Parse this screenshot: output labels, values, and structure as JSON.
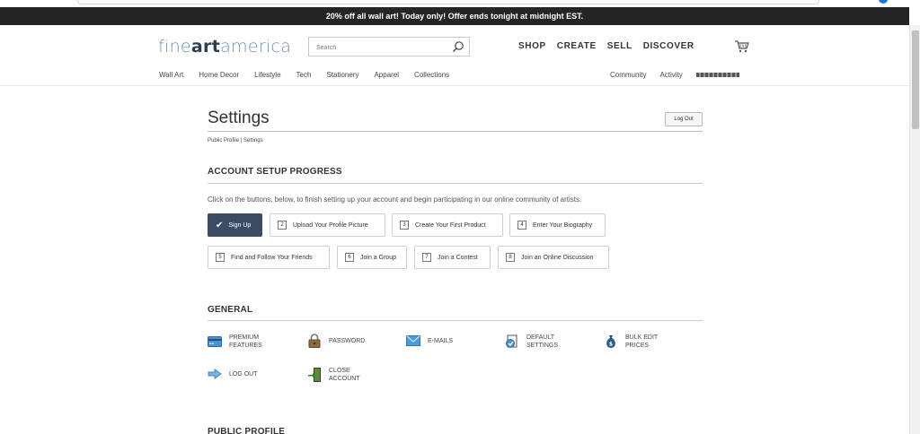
{
  "promo": {
    "text": "20% off all wall art!  Today only!  Offer ends tonight at midnight EST."
  },
  "header": {
    "logo_prefix": "fine",
    "logo_bold": "art",
    "logo_suffix": "america",
    "search_placeholder": "Search",
    "nav": [
      "SHOP",
      "CREATE",
      "SELL",
      "DISCOVER"
    ],
    "sub_nav": [
      "Wall Art",
      "Home Decor",
      "Lifestyle",
      "Tech",
      "Stationery",
      "Apparel",
      "Collections"
    ],
    "sub_right": [
      "Community",
      "Activity"
    ]
  },
  "page": {
    "title": "Settings",
    "logout_label": "Log Out",
    "breadcrumb": "Public Profile  |  Settings"
  },
  "setup": {
    "title": "ACCOUNT SETUP PROGRESS",
    "intro": "Click on the buttons, below, to finish setting up your account and begin participating in our online community of artists.",
    "steps": [
      {
        "num": "",
        "label": "Sign Up",
        "done": true
      },
      {
        "num": "2",
        "label": "Upload Your Profile Picture"
      },
      {
        "num": "3",
        "label": "Create Your First Product"
      },
      {
        "num": "4",
        "label": "Enter Your Biography"
      },
      {
        "num": "5",
        "label": "Find and Follow Your Friends"
      },
      {
        "num": "6",
        "label": "Join a Group"
      },
      {
        "num": "7",
        "label": "Join a Contest"
      },
      {
        "num": "8",
        "label": "Join an Online Discussion"
      }
    ]
  },
  "general": {
    "title": "GENERAL",
    "items": [
      {
        "line1": "PREMIUM",
        "line2": "FEATURES",
        "icon": "credit-card-icon"
      },
      {
        "line1": "PASSWORD",
        "line2": "",
        "icon": "padlock-icon"
      },
      {
        "line1": "E-MAILS",
        "line2": "",
        "icon": "envelope-icon"
      },
      {
        "line1": "DEFAULT",
        "line2": "SETTINGS",
        "icon": "settings-document-icon"
      },
      {
        "line1": "BULK EDIT",
        "line2": "PRICES",
        "icon": "money-bag-icon"
      },
      {
        "line1": "LOG OUT",
        "line2": "",
        "icon": "arrow-right-icon"
      },
      {
        "line1": "CLOSE",
        "line2": "ACCOUNT",
        "icon": "exit-door-icon"
      }
    ]
  },
  "public_profile": {
    "title": "PUBLIC PROFILE"
  },
  "colors": {
    "banner": "#252525",
    "logo_blue": "#6a93b8",
    "done_button": "#3b4b63"
  }
}
